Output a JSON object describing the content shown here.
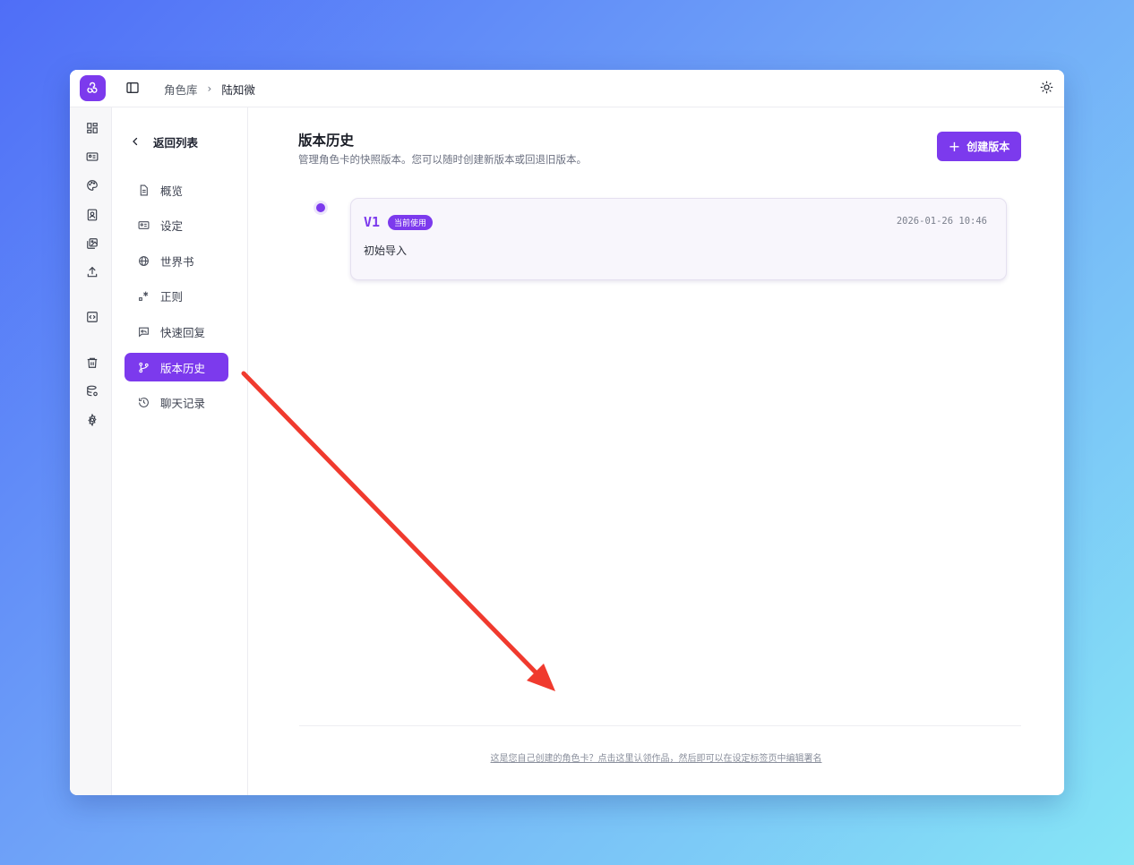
{
  "header": {
    "breadcrumb": [
      "角色库",
      "陆知微"
    ],
    "breadcrumb_separator": "›"
  },
  "rail": {
    "icons": [
      "dashboard-icon",
      "id-card-icon",
      "palette-icon",
      "contacts-icon",
      "images-icon",
      "upload-icon",
      "code-icon",
      "trash-icon",
      "database-icon",
      "settings-icon"
    ]
  },
  "subnav": {
    "back_label": "返回列表",
    "items": [
      {
        "label": "概览",
        "icon": "document-icon",
        "active": false
      },
      {
        "label": "设定",
        "icon": "id-card-icon",
        "active": false
      },
      {
        "label": "世界书",
        "icon": "globe-icon",
        "active": false
      },
      {
        "label": "正则",
        "icon": "regex-icon",
        "active": false
      },
      {
        "label": "快速回复",
        "icon": "reply-icon",
        "active": false
      },
      {
        "label": "版本历史",
        "icon": "git-branch-icon",
        "active": true
      },
      {
        "label": "聊天记录",
        "icon": "history-icon",
        "active": false
      }
    ]
  },
  "main": {
    "title": "版本历史",
    "subtitle": "管理角色卡的快照版本。您可以随时创建新版本或回退旧版本。",
    "create_button": "创建版本",
    "versions": [
      {
        "tag": "V1",
        "badge": "当前使用",
        "time": "2026-01-26 10:46",
        "note": "初始导入"
      }
    ],
    "claim_link": "这是您自己创建的角色卡？点击这里认领作品，然后即可以在设定标签页中编辑署名"
  },
  "colors": {
    "accent": "#7c3aed",
    "annotation_arrow": "#f03a2e"
  }
}
